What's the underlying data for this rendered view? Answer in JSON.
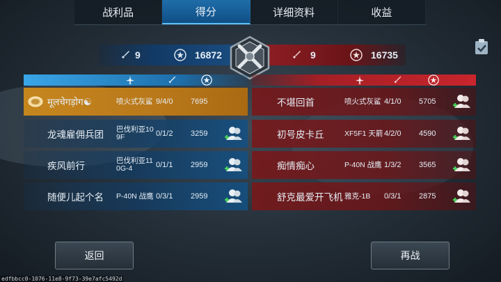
{
  "tabs": [
    {
      "label": "战利品",
      "active": false
    },
    {
      "label": "得分",
      "active": true
    },
    {
      "label": "详细资料",
      "active": false
    },
    {
      "label": "收益",
      "active": false
    }
  ],
  "blue_team": {
    "kills": "9",
    "score": "16872",
    "players": [
      {
        "name": "मूलचेगड़ोग☯",
        "plane": "喷火式灰鲨",
        "kda": "9/4/0",
        "score": "7695",
        "is_self": true
      },
      {
        "name": "龙魂雇佣兵团",
        "plane": "巴伐利亚109F",
        "kda": "0/1/2",
        "score": "3259",
        "is_self": false
      },
      {
        "name": "疾风前行",
        "plane": "巴伐利亚110G-4",
        "kda": "0/1/1",
        "score": "2959",
        "is_self": false
      },
      {
        "name": "随便儿起个名",
        "plane": "P-40N 战鹰",
        "kda": "0/3/1",
        "score": "2959",
        "is_self": false
      }
    ]
  },
  "red_team": {
    "kills": "9",
    "score": "16735",
    "players": [
      {
        "name": "不堪回首",
        "plane": "喷火式灰鲨",
        "kda": "4/1/0",
        "score": "5705"
      },
      {
        "name": "初号皮卡丘",
        "plane": "XF5F1 天箭",
        "kda": "4/2/0",
        "score": "4590"
      },
      {
        "name": "痴情痴心",
        "plane": "P-40N 战鹰",
        "kda": "1/3/2",
        "score": "3565"
      },
      {
        "name": "舒克最爱开飞机",
        "plane": "雅克-1B",
        "kda": "0/3/1",
        "score": "2875"
      }
    ]
  },
  "buttons": {
    "back": "返回",
    "rematch": "再战"
  },
  "footer_id": "edfbbcc0-1076-11e8-9f73-39e7afc5492d",
  "colors": {
    "blue_accent": "#1f6da9",
    "red_accent": "#c9252c",
    "self_highlight": "#c6861e"
  },
  "icons": {
    "kills": "sword-icon",
    "score": "star-badge-icon",
    "planes": "plane-icon",
    "add_friend": "add-friend-icon",
    "self_badge": "rank-badge-icon"
  }
}
